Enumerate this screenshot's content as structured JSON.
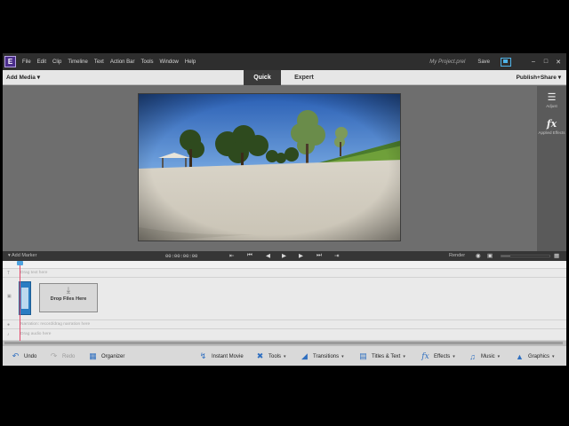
{
  "menubar": {
    "logo_letter": "E",
    "items": [
      "File",
      "Edit",
      "Clip",
      "Timeline",
      "Text",
      "Action Bar",
      "Tools",
      "Window",
      "Help"
    ],
    "project_name": "My Project.prel",
    "save_label": "Save"
  },
  "modebar": {
    "add_media": "Add Media",
    "tabs": [
      "Quick",
      "Expert"
    ],
    "active_tab": "Quick",
    "publish_share": "Publish+Share"
  },
  "right_panel": {
    "adjust_label": "Adjust",
    "effects_label": "Applied Effects"
  },
  "transport": {
    "add_marker": "Add Marker",
    "timecode": "00:00:00:00",
    "render_label": "Render",
    "zoom_level": 0.18
  },
  "timeline": {
    "tracks": {
      "text_track": "Drag text here",
      "narration_track": "Narration: record/drag narration here",
      "audio_track": "Drag audio here"
    },
    "drop_zone_label": "Drop Files Here"
  },
  "actionbar": {
    "undo": "Undo",
    "redo": "Redo",
    "organizer": "Organizer",
    "instant_movie": "Instant Movie",
    "tools": "Tools",
    "transitions": "Transitions",
    "titles_text": "Titles & Text",
    "effects": "Effects",
    "music": "Music",
    "graphics": "Graphics"
  },
  "colors": {
    "accent_blue": "#4fa3e0",
    "playhead": "#e4476a",
    "active_tab_bg": "#3a3a3a",
    "menubar_bg": "#2e2e2e"
  }
}
